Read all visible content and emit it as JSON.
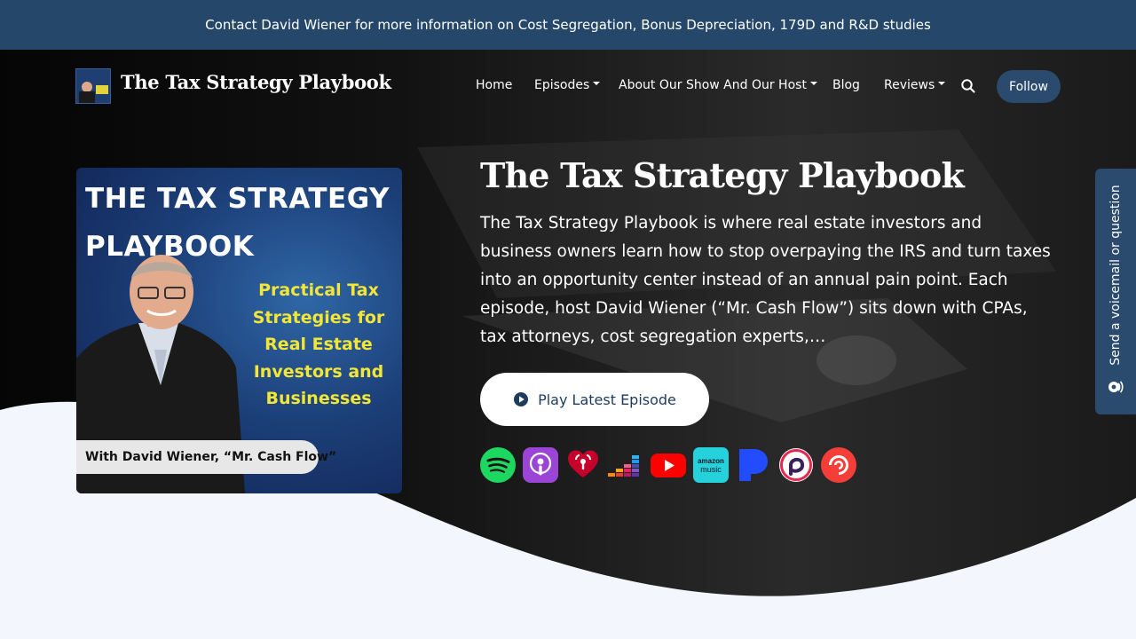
{
  "announcement": "Contact David Wiener for more information on Cost Segregation, Bonus Depreciation, 179D and R&D studies",
  "site": {
    "title": "The Tax Strategy Playbook"
  },
  "nav": {
    "items": [
      {
        "label": "Home",
        "dropdown": false
      },
      {
        "label": "Episodes",
        "dropdown": true
      },
      {
        "label": "About Our Show And Our Host",
        "dropdown": true
      },
      {
        "label": "Blog",
        "dropdown": false
      },
      {
        "label": "Reviews",
        "dropdown": true
      }
    ],
    "search_icon": "search-icon",
    "follow_label": "Follow"
  },
  "cover": {
    "title": "THE TAX STRATEGY\nPLAYBOOK",
    "subtitle": "Practical Tax\nStrategies for\nReal Estate\nInvestors and\nBusinesses",
    "caption": "With David Wiener, “Mr. Cash Flow”"
  },
  "hero": {
    "title": "The Tax Strategy Playbook",
    "description": "The Tax Strategy Playbook is where real estate investors and business owners learn how to stop overpaying the IRS and turn taxes into an opportunity center instead of an annual pain point. Each episode, host David Wiener (“Mr. Cash Flow”) sits down with CPAs, tax attorneys, cost segregation experts,…",
    "play_label": "Play Latest Episode"
  },
  "platforms": [
    "spotify-icon",
    "apple-podcasts-icon",
    "iheartradio-icon",
    "deezer-icon",
    "youtube-icon",
    "amazon-music-icon",
    "pandora-icon",
    "podcast-addict-icon",
    "pocket-casts-icon"
  ],
  "amazon_icon_text": {
    "line1": "amazon",
    "line2": "music"
  },
  "voicemail": {
    "label": "Send a voicemail or question"
  },
  "colors": {
    "topbar": "#25476a",
    "accent": "#2a4a6e",
    "cover_yellow": "#f3e636",
    "page_bg": "#f3f7fd"
  }
}
